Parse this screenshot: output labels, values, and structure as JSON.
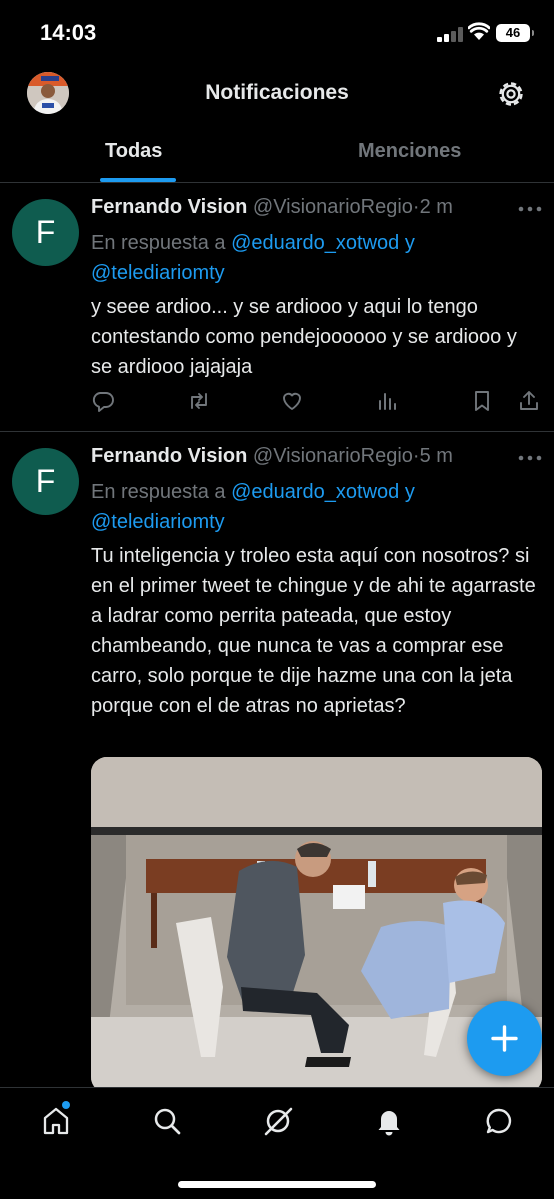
{
  "status_bar": {
    "time": "14:03",
    "battery": "46",
    "icons": [
      "cellular-signal-icon",
      "wifi-icon",
      "battery-icon"
    ]
  },
  "header": {
    "title": "Notificaciones",
    "avatar_icon": "profile-avatar",
    "settings_icon": "gear-icon"
  },
  "tabs": [
    {
      "label": "Todas",
      "active": true
    },
    {
      "label": "Menciones",
      "active": false
    }
  ],
  "tweets": [
    {
      "avatar_letter": "F",
      "name": "Fernando Vision",
      "handle": "@VisionarioRegio",
      "separator": "·",
      "time": "2 m",
      "reply_prefix": "En respuesta a",
      "reply_user1": "@eduardo_xotwod",
      "reply_joiner": "y",
      "reply_user2": "@telediariomty",
      "text": "y seee ardioo... y se ardiooo y aqui lo tengo contestando como pendejoooooo y se ardiooo y se ardiooo jajajaja",
      "actions": [
        "reply-icon",
        "retweet-icon",
        "like-icon",
        "views-icon",
        "bookmark-icon",
        "share-icon"
      ]
    },
    {
      "avatar_letter": "F",
      "name": "Fernando Vision",
      "handle": "@VisionarioRegio",
      "separator": "·",
      "time": "5 m",
      "reply_prefix": "En respuesta a",
      "reply_user1": "@eduardo_xotwod",
      "reply_joiner": "y",
      "reply_user2": "@telediariomty",
      "text": "Tu inteligencia y troleo esta aquí con nosotros? si en el primer tweet te chingue y de ahi te agarraste a ladrar como perrita pateada, que estoy chambeando, que nunca te vas a comprar ese carro, solo porque te dije hazme una con la jeta porque con el de atras no aprietas?",
      "media": "photo"
    }
  ],
  "fab_icon": "compose-plus-icon",
  "bottom_nav": [
    "home-icon",
    "search-icon",
    "grok-icon",
    "notifications-bell-icon",
    "messages-icon"
  ],
  "colors": {
    "background": "#000000",
    "accent": "#1d9bf0",
    "text_primary": "#e7e9ea",
    "text_secondary": "#71767b",
    "avatar_bg": "#0f5c4f"
  }
}
